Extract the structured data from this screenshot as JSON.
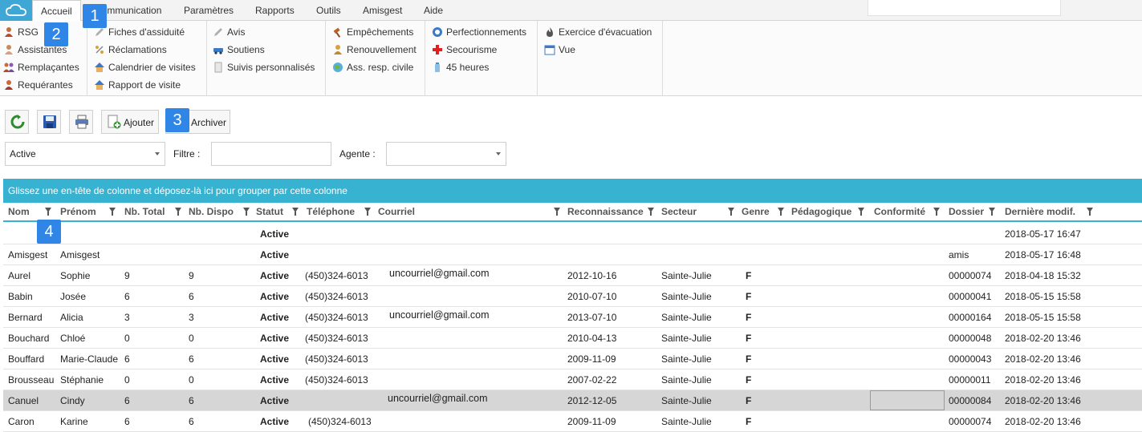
{
  "menu": {
    "tabs": [
      "Accueil",
      "Communication",
      "Paramètres",
      "Rapports",
      "Outils",
      "Amisgest",
      "Aide"
    ]
  },
  "ribbon": {
    "groups": [
      [
        "RSG",
        "Assistantes",
        "Remplaçantes",
        "Requérantes"
      ],
      [
        "Fiches d'assiduité",
        "Réclamations",
        "Calendrier de visites",
        "Rapport de visite"
      ],
      [
        "Avis",
        "Soutiens",
        "Suivis personnalisés"
      ],
      [
        "Empêchements",
        "Renouvellement",
        "Ass. resp. civile"
      ],
      [
        "Perfectionnements",
        "Secourisme",
        "45 heures"
      ],
      [
        "Exercice d'évacuation",
        "Vue"
      ]
    ]
  },
  "badges": [
    "1",
    "2",
    "3",
    "4"
  ],
  "toolbar": {
    "add_label": "Ajouter",
    "archive_label": "Archiver"
  },
  "filters": {
    "status_value": "Active",
    "filter_label": "Filtre :",
    "filter_value": "",
    "agent_label": "Agente :",
    "agent_value": ""
  },
  "grid": {
    "group_hint": "Glissez une en-tête de colonne et déposez-là ici pour grouper par cette colonne",
    "columns": [
      "Nom",
      "Prénom",
      "Nb. Total",
      "Nb. Dispo",
      "Statut",
      "Téléphone",
      "Courriel",
      "Reconnaissance",
      "Secteur",
      "Genre",
      "Pédagogique",
      "Conformité",
      "Dossier",
      "Dernière modif."
    ],
    "rows": [
      [
        "",
        "",
        "",
        "",
        "Active",
        "",
        "",
        "",
        "",
        "",
        "",
        "",
        "",
        "2018-05-17 16:47"
      ],
      [
        "Amisgest",
        "Amisgest",
        "",
        "",
        "Active",
        "",
        "",
        "",
        "",
        "",
        "",
        "",
        "amis",
        "2018-05-17 16:48"
      ],
      [
        "Aurel",
        "Sophie",
        "9",
        "9",
        "Active",
        "(450)324-6013",
        "uncourriel@gmail.com",
        "2012-10-16",
        "Sainte-Julie",
        "F",
        "",
        "",
        "00000074",
        "2018-04-18 15:32"
      ],
      [
        "Babin",
        "Josée",
        "6",
        "6",
        "Active",
        "(450)324-6013",
        "",
        "2010-07-10",
        "Sainte-Julie",
        "F",
        "",
        "",
        "00000041",
        "2018-05-15 15:58"
      ],
      [
        "Bernard",
        "Alicia",
        "3",
        "3",
        "Active",
        "(450)324-6013",
        "uncourriel@gmail.com",
        "2013-07-10",
        "Sainte-Julie",
        "F",
        "",
        "",
        "00000164",
        "2018-05-15 15:58"
      ],
      [
        "Bouchard",
        "Chloé",
        "0",
        "0",
        "Active",
        "(450)324-6013",
        "",
        "2010-04-13",
        "Sainte-Julie",
        "F",
        "",
        "",
        "00000048",
        "2018-02-20 13:46"
      ],
      [
        "Bouffard",
        "Marie-Claude",
        "6",
        "6",
        "Active",
        "(450)324-6013",
        "",
        "2009-11-09",
        "Sainte-Julie",
        "F",
        "",
        "",
        "00000043",
        "2018-02-20 13:46"
      ],
      [
        "Brousseau",
        "Stéphanie",
        "0",
        "0",
        "Active",
        "(450)324-6013",
        "",
        "2007-02-22",
        "Sainte-Julie",
        "F",
        "",
        "",
        "00000011",
        "2018-02-20 13:46"
      ],
      [
        "Canuel",
        "Cindy",
        "6",
        "6",
        "Active",
        "",
        "uncourriel@gmail.com",
        "2012-12-05",
        "Sainte-Julie",
        "F",
        "",
        "",
        "00000084",
        "2018-02-20 13:46"
      ],
      [
        "Caron",
        "Karine",
        "6",
        "6",
        "Active",
        "(450)324-6013",
        "",
        "2009-11-09",
        "Sainte-Julie",
        "F",
        "",
        "",
        "00000074",
        "2018-02-20 13:46"
      ]
    ],
    "selected_row": 8,
    "colors": {
      "accent": "#37b3d1",
      "selected": "#d6d6d6"
    }
  }
}
